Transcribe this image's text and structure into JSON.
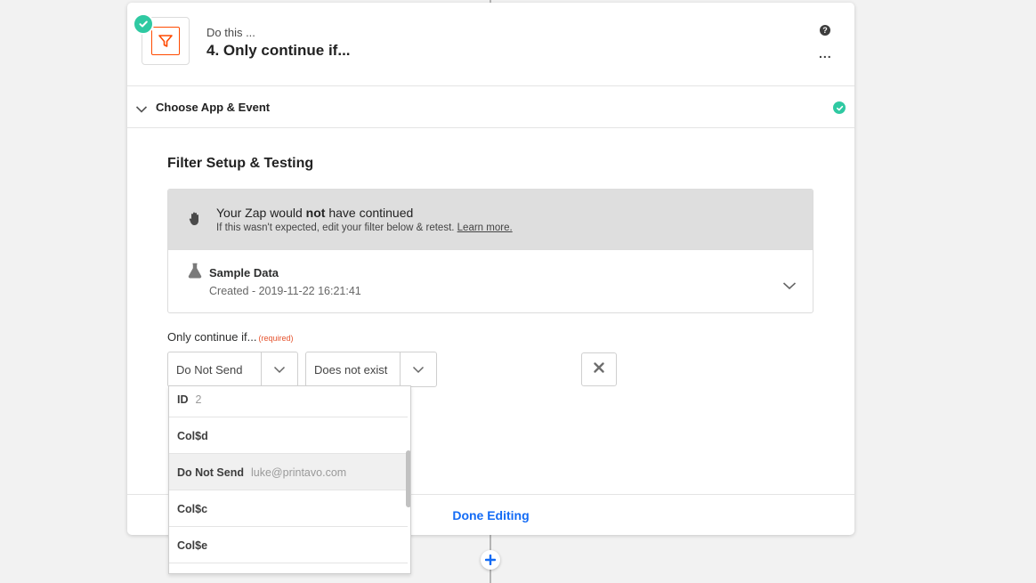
{
  "step": {
    "subtitle": "Do this ...",
    "title": "4. Only continue if...",
    "help_icon": "?",
    "more_icon": "..."
  },
  "section": {
    "title": "Choose App & Event"
  },
  "filter": {
    "heading": "Filter Setup & Testing",
    "banner": {
      "pre": "Your Zap would ",
      "bold": "not",
      "post": " have continued",
      "sub": "If this wasn't expected, edit your filter below & retest. ",
      "link": "Learn more."
    },
    "sample": {
      "title": "Sample Data",
      "created": "Created - 2019-11-22 16:21:41"
    },
    "condition_label": "Only continue if...",
    "required_label": "(required)",
    "field_select": "Do Not Send",
    "operator_select": "Does not exist"
  },
  "dropdown": {
    "options": [
      {
        "key": "ID",
        "value": "2"
      },
      {
        "key": "Col$d",
        "value": ""
      },
      {
        "key": "Do Not Send",
        "value": "luke@printavo.com"
      },
      {
        "key": "Col$c",
        "value": ""
      },
      {
        "key": "Col$e",
        "value": ""
      }
    ]
  },
  "footer": {
    "done_label": "Done Editing"
  },
  "colors": {
    "accent": "#136bf5",
    "success": "#2fc9a2",
    "filter_orange": "#ff4a00",
    "required_red": "#e5532e"
  },
  "icons": [
    "check-circle-icon",
    "filter-icon",
    "help-icon",
    "more-icon",
    "chevron-down-icon",
    "hand-icon",
    "flask-icon",
    "close-icon",
    "plus-icon"
  ]
}
